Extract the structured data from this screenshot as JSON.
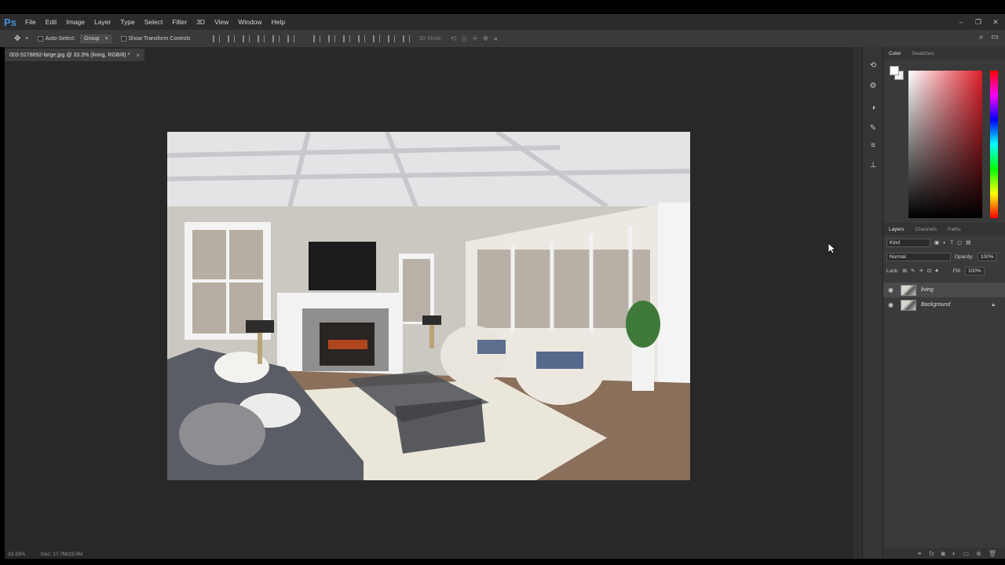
{
  "app": {
    "logo": "Ps"
  },
  "menu": [
    "File",
    "Edit",
    "Image",
    "Layer",
    "Type",
    "Select",
    "Filter",
    "3D",
    "View",
    "Window",
    "Help"
  ],
  "window_controls": [
    "–",
    "❐",
    "✕"
  ],
  "options": {
    "auto_select_label": "Auto-Select:",
    "auto_select_value": "Group",
    "transform_label": "Show Transform Controls",
    "mode_3d_label": "3D Mode:"
  },
  "document": {
    "tab_title": "003-5278692-large.jpg @ 33.3% (living, RGB/8) *",
    "close": "×"
  },
  "status": {
    "zoom": "33.33%",
    "doc": "Doc: 17.7M/23.5M"
  },
  "color_panel": {
    "tabs": [
      "Color",
      "Swatches"
    ]
  },
  "layers_panel": {
    "tabs": [
      "Layers",
      "Channels",
      "Paths"
    ],
    "kind": "Kind",
    "blend_mode": "Normal",
    "opacity_label": "Opacity:",
    "opacity_value": "100%",
    "lock_label": "Lock:",
    "fill_label": "Fill:",
    "fill_value": "100%",
    "layers": [
      {
        "name": "living",
        "visible": true,
        "selected": true,
        "locked": false
      },
      {
        "name": "Background",
        "visible": true,
        "selected": false,
        "locked": true
      }
    ]
  },
  "colors": {
    "accent": "#4a90d9",
    "panel": "#3a3a3a",
    "canvas": "#282828"
  }
}
